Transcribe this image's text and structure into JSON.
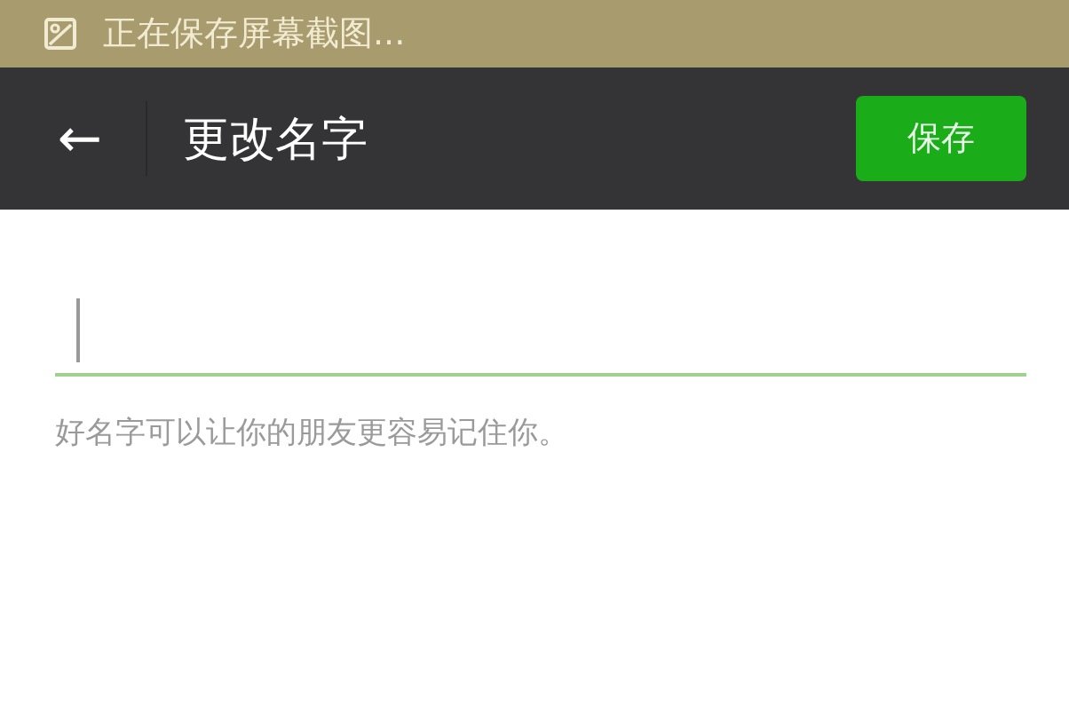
{
  "status_bar": {
    "notification": "正在保存屏幕截图..."
  },
  "app_bar": {
    "back_icon": "←",
    "title": "更改名字",
    "save_button": "保存"
  },
  "name_field": {
    "focused": true
  },
  "hint": "好名字可以让你的朋友更容易记住你。"
}
